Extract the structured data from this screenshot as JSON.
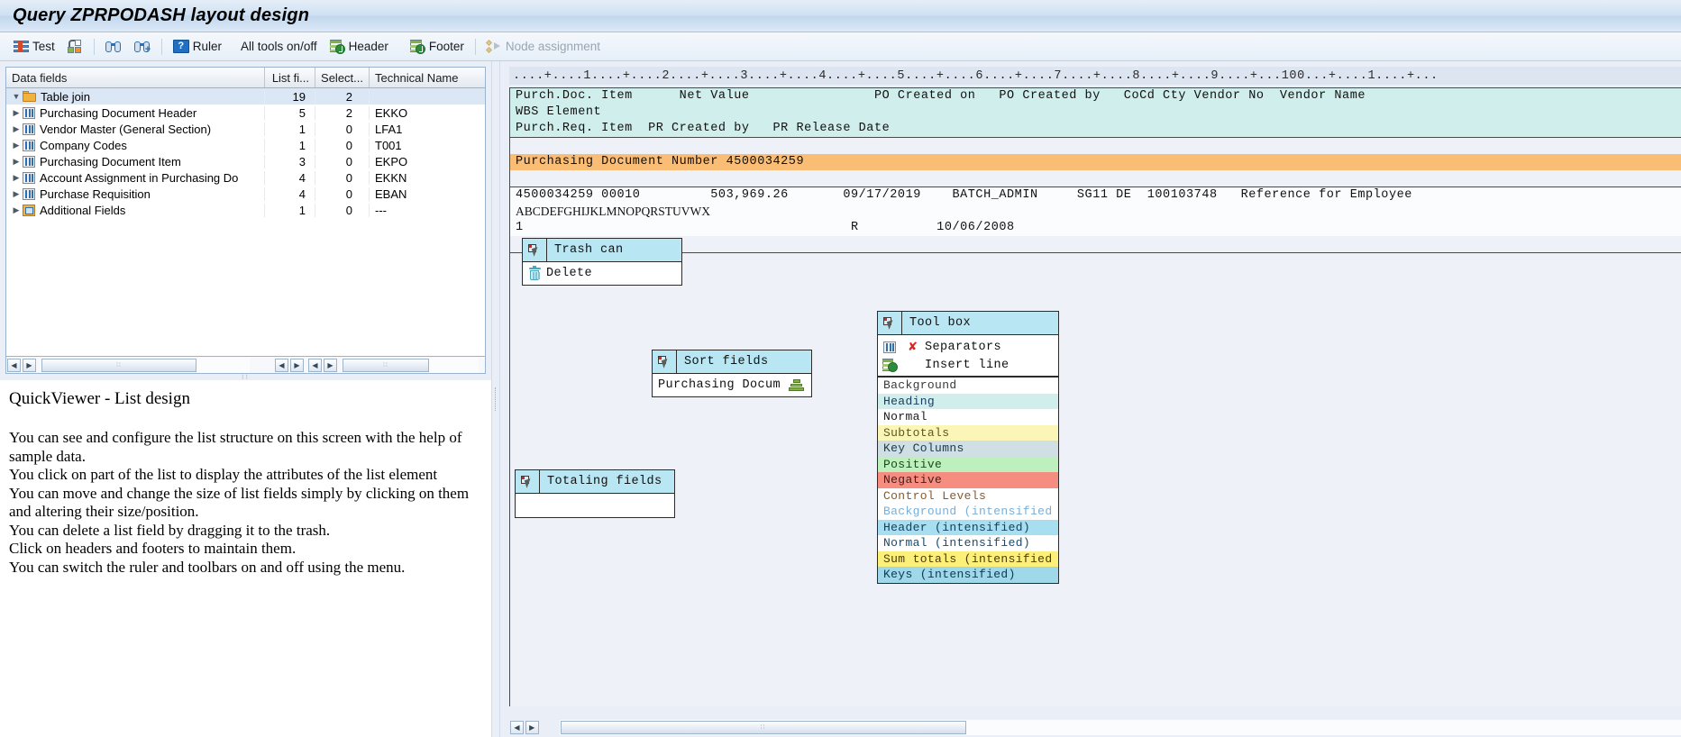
{
  "window": {
    "title": "Query ZPRPODASH layout design"
  },
  "toolbar": {
    "items": [
      {
        "label": "Test",
        "icon": "test-icon",
        "disabled": false
      },
      {
        "label": "",
        "icon": "blocks-icon",
        "disabled": false
      },
      {
        "label": "",
        "icon": "binoculars-icon",
        "disabled": false
      },
      {
        "label": "",
        "icon": "binoculars-plus-icon",
        "disabled": false
      },
      {
        "label": "Ruler",
        "icon": "ruler-icon",
        "disabled": false
      },
      {
        "label": "All tools on/off",
        "icon": "",
        "disabled": false
      },
      {
        "label": "Header",
        "icon": "header-icon",
        "disabled": false
      },
      {
        "label": "Footer",
        "icon": "footer-icon",
        "disabled": false
      },
      {
        "label": "Node assignment",
        "icon": "node-assignment-icon",
        "disabled": true
      }
    ]
  },
  "tree": {
    "columns": [
      "Data fields",
      "List fi...",
      "Select...",
      "Technical Name"
    ],
    "rows": [
      {
        "label": "Table join",
        "list_fields": "19",
        "selected": "2",
        "technical": "",
        "icon": "folder-icon",
        "level": 0,
        "expanded": true,
        "selectedRow": true
      },
      {
        "label": "Purchasing Document Header",
        "list_fields": "5",
        "selected": "2",
        "technical": "EKKO",
        "icon": "table-icon",
        "level": 1,
        "expanded": false,
        "selectedRow": false
      },
      {
        "label": "Vendor Master (General Section)",
        "list_fields": "1",
        "selected": "0",
        "technical": "LFA1",
        "icon": "table-icon",
        "level": 1,
        "expanded": false,
        "selectedRow": false
      },
      {
        "label": "Company Codes",
        "list_fields": "1",
        "selected": "0",
        "technical": "T001",
        "icon": "table-icon",
        "level": 1,
        "expanded": false,
        "selectedRow": false
      },
      {
        "label": "Purchasing Document Item",
        "list_fields": "3",
        "selected": "0",
        "technical": "EKPO",
        "icon": "table-icon",
        "level": 1,
        "expanded": false,
        "selectedRow": false
      },
      {
        "label": "Account Assignment in Purchasing Do",
        "list_fields": "4",
        "selected": "0",
        "technical": "EKKN",
        "icon": "table-icon",
        "level": 1,
        "expanded": false,
        "selectedRow": false
      },
      {
        "label": "Purchase Requisition",
        "list_fields": "4",
        "selected": "0",
        "technical": "EBAN",
        "icon": "table-icon",
        "level": 1,
        "expanded": false,
        "selectedRow": false
      },
      {
        "label": "Additional Fields",
        "list_fields": "1",
        "selected": "0",
        "technical": "---",
        "icon": "additional-fields-icon",
        "level": 1,
        "expanded": false,
        "selectedRow": false
      }
    ]
  },
  "help": {
    "heading": "QuickViewer - List design",
    "lines": [
      "You can see and configure the list structure on this screen with the help of",
      "sample data.",
      "You click on part of the list to display the attributes of the list element",
      "You can move and change the size of list fields simply by clicking on them",
      "and altering their size/position.",
      "You can delete a list field by dragging it to the trash.",
      "Click on headers and footers to maintain them.",
      "You can switch the ruler and toolbars on and off using the menu."
    ]
  },
  "list_design": {
    "ruler": "....+....1....+....2....+....3....+....4....+....5....+....6....+....7....+....8....+....9....+...100...+....1....+...",
    "header_rows": [
      "Purch.Doc. Item      Net Value                PO Created on   PO Created by   CoCd Cty Vendor No  Vendor Name",
      "WBS Element",
      "Purch.Req. Item  PR Created by   PR Release Date"
    ],
    "control_level": "Purchasing Document Number 4500034259",
    "data_rows": [
      "4500034259 00010         503,969.26       09/17/2019    BATCH_ADMIN     SG11 DE  100103748   Reference for Employee",
      "ABCDEFGHIJKLMNOPQRSTUVWX",
      "1                                          R          10/06/2008"
    ]
  },
  "palettes": {
    "trash_can": {
      "caption": "Trash can",
      "handle_icon": "move-handle-icon",
      "items": [
        {
          "label": "Delete",
          "icon": "trash-icon"
        }
      ]
    },
    "sort_fields": {
      "caption": "Sort fields",
      "handle_icon": "move-handle-icon",
      "items": [
        {
          "label": "Purchasing Docum",
          "icon": "sort-stack-icon"
        }
      ]
    },
    "totaling_fields": {
      "caption": "Totaling fields",
      "handle_icon": "move-handle-icon",
      "items": [
        {
          "label": "",
          "icon": ""
        }
      ]
    },
    "tool_box": {
      "caption": "Tool box",
      "handle_icon": "move-handle-icon",
      "tools": [
        {
          "label": "Separators",
          "icon": "separators-icon",
          "extra_icon": "delete-x-icon"
        },
        {
          "label": "Insert line",
          "icon": "insert-line-icon",
          "extra_icon": ""
        }
      ],
      "color_legend": [
        {
          "label": "Background",
          "bg": "#ffffff",
          "fg": "#3a3a3a"
        },
        {
          "label": "Heading",
          "bg": "#cfeeec",
          "fg": "#1b3a5c"
        },
        {
          "label": "Normal",
          "bg": "#ffffff",
          "fg": "#1b1b1b"
        },
        {
          "label": "Subtotals",
          "bg": "#fbf5b8",
          "fg": "#4a4a1b"
        },
        {
          "label": "Key Columns",
          "bg": "#cfdfe4",
          "fg": "#1b3a4c"
        },
        {
          "label": "Positive",
          "bg": "#bdf0bd",
          "fg": "#1b4a1b"
        },
        {
          "label": "Negative",
          "bg": "#f58e80",
          "fg": "#4a1b1b"
        },
        {
          "label": "Control Levels",
          "bg": "#ffffff",
          "fg": "#8a4a1b"
        },
        {
          "label": "Background (intensified",
          "bg": "#ffffff",
          "fg": "#6fa8d6"
        },
        {
          "label": "Header (intensified)",
          "bg": "#a8dff0",
          "fg": "#14405c"
        },
        {
          "label": "Normal (intensified)",
          "bg": "#ffffff",
          "fg": "#1b4a6c"
        },
        {
          "label": "Sum totals (intensified",
          "bg": "#fdf07a",
          "fg": "#4a3a0b"
        },
        {
          "label": "Keys (intensified)",
          "bg": "#9fd8e8",
          "fg": "#0d3a52"
        }
      ]
    }
  }
}
